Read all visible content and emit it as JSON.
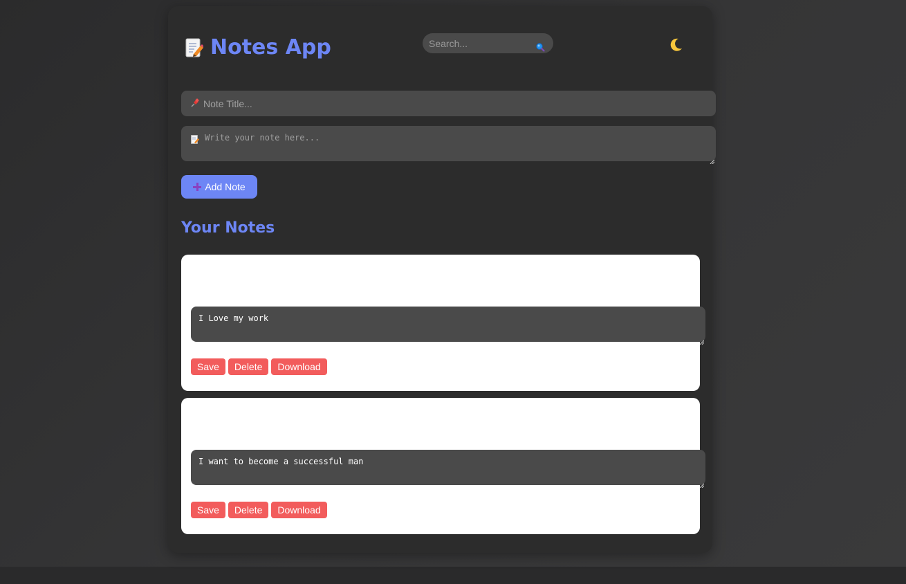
{
  "app": {
    "title": "Notes App",
    "logo_icon": "memo-icon",
    "accent_color": "#6d86f5"
  },
  "search": {
    "placeholder": "Search...",
    "value": "",
    "icon": "search-icon"
  },
  "theme_toggle": {
    "icon": "moon-icon"
  },
  "editor": {
    "title_placeholder": "Note Title...",
    "title_icon": "pushpin-icon",
    "content_placeholder": "Write your note here...",
    "content_icon": "memo-icon",
    "add_label": "Add Note",
    "add_icon": "plus-icon"
  },
  "notes_section": {
    "heading": "Your Notes"
  },
  "notes": [
    {
      "title": "",
      "content": "I Love my work",
      "save_label": "Save",
      "delete_label": "Delete",
      "download_label": "Download"
    },
    {
      "title": "",
      "content": "I want to become a successful man",
      "save_label": "Save",
      "delete_label": "Delete",
      "download_label": "Download"
    }
  ],
  "colors": {
    "panel": "#2c2c2c",
    "field": "#4a4a4a",
    "action_button": "#f25c5c",
    "card": "#ffffff"
  }
}
